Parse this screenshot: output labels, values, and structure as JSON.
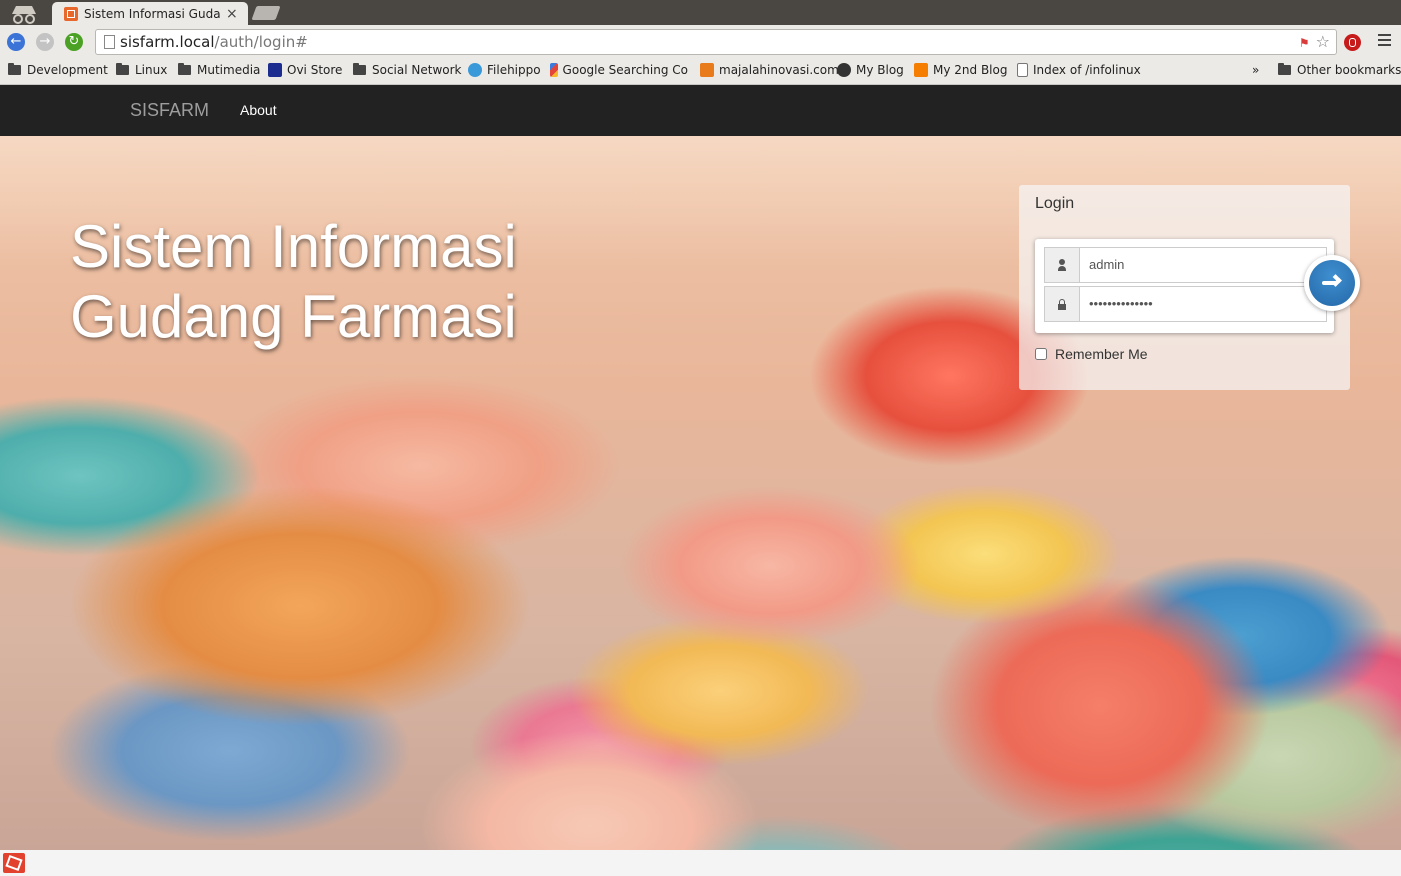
{
  "browser": {
    "tab": {
      "title": "Sistem Informasi Gudang",
      "close": "×"
    },
    "url": {
      "host": "sisfarm.local",
      "path": "/auth/login#"
    },
    "bookmarks": [
      {
        "label": "Development",
        "icon": "folder-icon"
      },
      {
        "label": "Linux",
        "icon": "folder-icon"
      },
      {
        "label": "Mutimedia",
        "icon": "folder-icon"
      },
      {
        "label": "Ovi Store",
        "icon": "ovi-icon"
      },
      {
        "label": "Social Network",
        "icon": "folder-icon"
      },
      {
        "label": "Filehippo",
        "icon": "filehippo-icon"
      },
      {
        "label": "Google Searching Co",
        "icon": "google-icon"
      },
      {
        "label": "majalahinovasi.com",
        "icon": "majalah-icon"
      },
      {
        "label": "My Blog",
        "icon": "blog-icon"
      },
      {
        "label": "My 2nd Blog",
        "icon": "blogger-icon"
      },
      {
        "label": "Index of /infolinux",
        "icon": "page-icon"
      }
    ],
    "more": "»",
    "other_bookmarks": "Other bookmarks"
  },
  "navbar": {
    "brand": "SISFARM",
    "about": "About"
  },
  "hero": {
    "title_line1": "Sistem Informasi",
    "title_line2": "Gudang Farmasi"
  },
  "login": {
    "heading": "Login",
    "username": "admin",
    "password": "••••••••••••••",
    "remember": "Remember Me"
  },
  "colors": {
    "navbar": "#222222",
    "accent": "#2a70b0"
  }
}
